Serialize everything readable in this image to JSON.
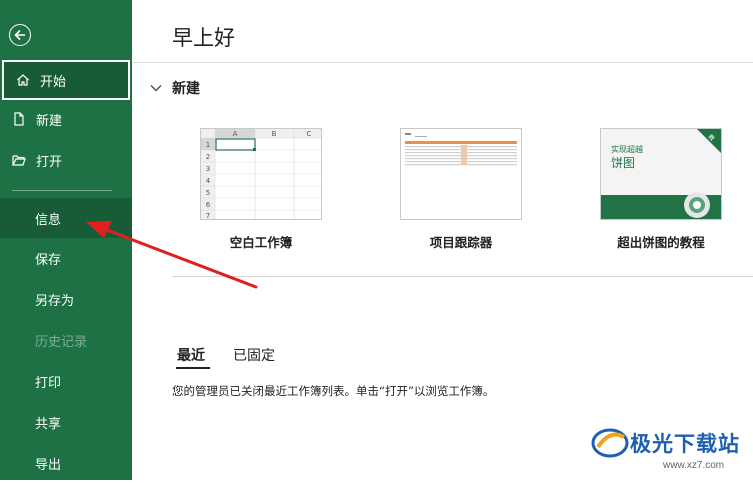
{
  "sidebar": {
    "items": [
      {
        "label": "开始",
        "icon": "home-icon"
      },
      {
        "label": "新建",
        "icon": "new-doc-icon"
      },
      {
        "label": "打开",
        "icon": "folder-open-icon"
      },
      {
        "label": "信息"
      },
      {
        "label": "保存"
      },
      {
        "label": "另存为"
      },
      {
        "label": "历史记录"
      },
      {
        "label": "打印"
      },
      {
        "label": "共享"
      },
      {
        "label": "导出"
      }
    ],
    "selected": "开始",
    "hovered": "信息",
    "disabled": "历史记录"
  },
  "main": {
    "greeting": "早上好",
    "new_section": {
      "title": "新建",
      "templates": [
        {
          "label": "空白工作簿"
        },
        {
          "label": "项目跟踪器"
        },
        {
          "label": "超出饼图的教程",
          "thumb_title": "实现超越",
          "thumb_subtitle": "饼图",
          "badge": "教"
        }
      ],
      "blank_grid": {
        "columns": [
          "A",
          "B",
          "C"
        ],
        "rows": [
          "1",
          "2",
          "3",
          "4",
          "5",
          "6",
          "7"
        ]
      }
    },
    "tabs": [
      {
        "label": "最近",
        "active": true
      },
      {
        "label": "已固定",
        "active": false
      }
    ],
    "notice": "您的管理员已关闭最近工作簿列表。单击“打开”以浏览工作簿。"
  },
  "watermark": {
    "text": "极光下载站",
    "url": "www.xz7.com"
  },
  "colors": {
    "sidebar": "#1e7145",
    "selected": "#185c37",
    "arrow": "#e02020",
    "excel_green": "#217346"
  }
}
